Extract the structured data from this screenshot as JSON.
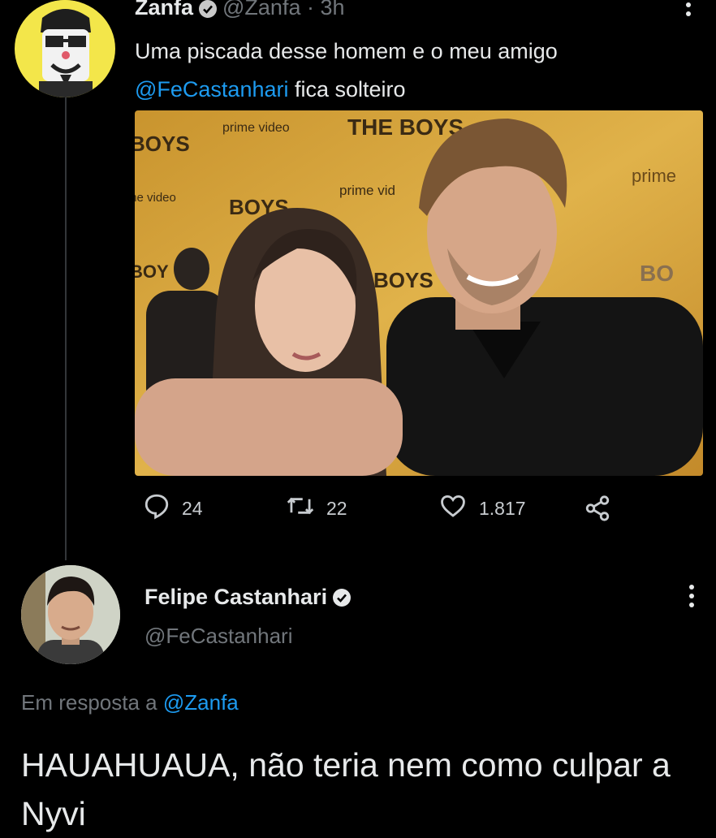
{
  "tweet1": {
    "display_name": "Zanfa",
    "handle": "@Zanfa",
    "time": "· 3h",
    "text_before": "Uma piscada desse homem e o meu amigo",
    "mention": "@FeCastanhari",
    "text_after": " fica solteiro",
    "media": {
      "backdrop_texts": [
        "prime video",
        "THE BOYS",
        "prime",
        "BOYS"
      ]
    },
    "stats": {
      "replies": "24",
      "retweets": "22",
      "likes": "1.817"
    }
  },
  "tweet2": {
    "display_name": "Felipe Castanhari",
    "handle": "@FeCastanhari",
    "reply_prefix": "Em resposta a",
    "reply_to": "@Zanfa",
    "text": "HAUAHUAUA, não teria nem como culpar a Nyvi"
  },
  "colors": {
    "background": "#000000",
    "text": "#e7e9ea",
    "secondary": "#71767b",
    "accent": "#1d9bf0",
    "backdrop": "#d7a63c"
  },
  "icons": [
    "verified-badge-icon",
    "more-options-icon",
    "reply-icon",
    "retweet-icon",
    "like-icon",
    "share-icon"
  ]
}
